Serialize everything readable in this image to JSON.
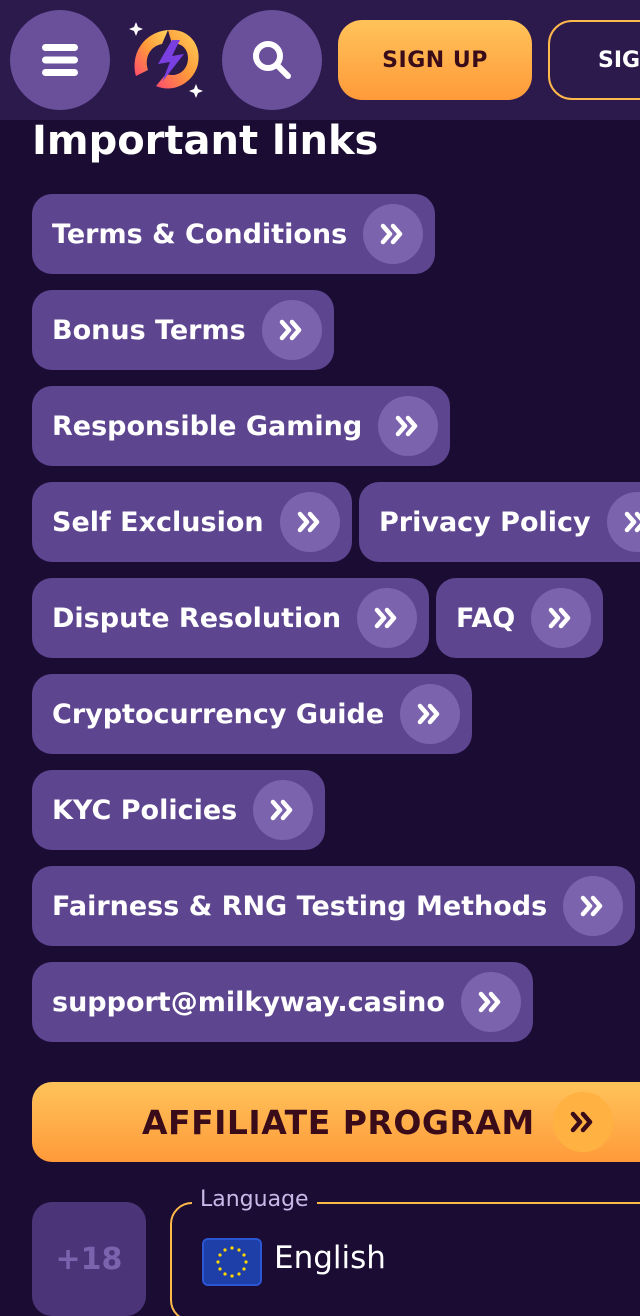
{
  "header": {
    "menu_icon": "hamburger-menu-icon",
    "logo": "milkyway-casino-logo",
    "search_icon": "search-icon",
    "signup_label": "SIGN UP",
    "signin_label": "SIGN IN",
    "accent_color": "#ff9a3a"
  },
  "links_section": {
    "title": "Important links",
    "arrow_icon": "double-chevron-right-icon",
    "items": [
      {
        "label": "Terms & Conditions"
      },
      {
        "label": "Bonus Terms"
      },
      {
        "label": "Responsible Gaming"
      },
      {
        "label": "Self Exclusion"
      },
      {
        "label": "Privacy Policy"
      },
      {
        "label": "Dispute Resolution"
      },
      {
        "label": "FAQ"
      },
      {
        "label": "Cryptocurrency Guide"
      },
      {
        "label": "KYC Policies"
      },
      {
        "label": "Fairness & RNG Testing Methods"
      },
      {
        "label": "support@milkyway.casino"
      }
    ]
  },
  "affiliate": {
    "label": "AFFILIATE PROGRAM"
  },
  "footer": {
    "age_badge": "+18",
    "language": {
      "legend": "Language",
      "flag": "eu-flag-icon",
      "value": "English"
    }
  }
}
